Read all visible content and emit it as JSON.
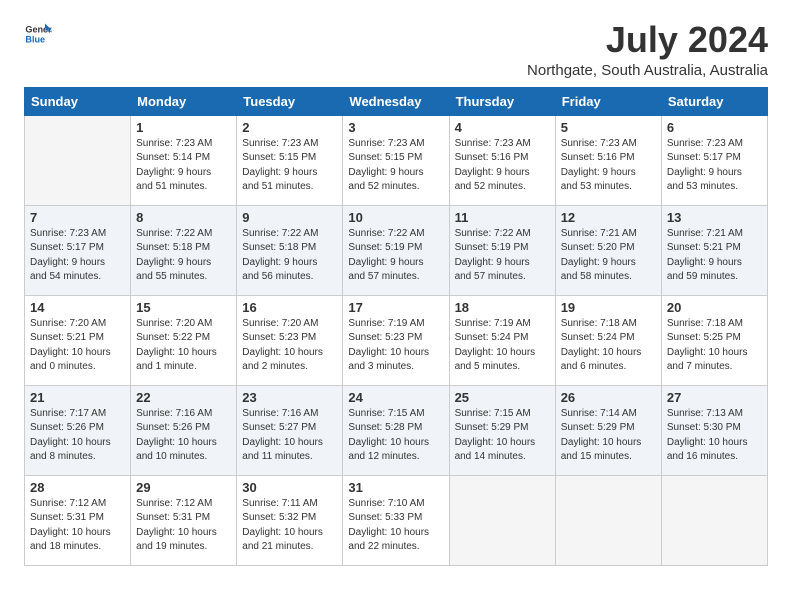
{
  "logo": {
    "general": "General",
    "blue": "Blue"
  },
  "title": {
    "month_year": "July 2024",
    "location": "Northgate, South Australia, Australia"
  },
  "weekdays": [
    "Sunday",
    "Monday",
    "Tuesday",
    "Wednesday",
    "Thursday",
    "Friday",
    "Saturday"
  ],
  "weeks": [
    [
      {
        "day": "",
        "info": ""
      },
      {
        "day": "1",
        "info": "Sunrise: 7:23 AM\nSunset: 5:14 PM\nDaylight: 9 hours\nand 51 minutes."
      },
      {
        "day": "2",
        "info": "Sunrise: 7:23 AM\nSunset: 5:15 PM\nDaylight: 9 hours\nand 51 minutes."
      },
      {
        "day": "3",
        "info": "Sunrise: 7:23 AM\nSunset: 5:15 PM\nDaylight: 9 hours\nand 52 minutes."
      },
      {
        "day": "4",
        "info": "Sunrise: 7:23 AM\nSunset: 5:16 PM\nDaylight: 9 hours\nand 52 minutes."
      },
      {
        "day": "5",
        "info": "Sunrise: 7:23 AM\nSunset: 5:16 PM\nDaylight: 9 hours\nand 53 minutes."
      },
      {
        "day": "6",
        "info": "Sunrise: 7:23 AM\nSunset: 5:17 PM\nDaylight: 9 hours\nand 53 minutes."
      }
    ],
    [
      {
        "day": "7",
        "info": "Sunrise: 7:23 AM\nSunset: 5:17 PM\nDaylight: 9 hours\nand 54 minutes."
      },
      {
        "day": "8",
        "info": "Sunrise: 7:22 AM\nSunset: 5:18 PM\nDaylight: 9 hours\nand 55 minutes."
      },
      {
        "day": "9",
        "info": "Sunrise: 7:22 AM\nSunset: 5:18 PM\nDaylight: 9 hours\nand 56 minutes."
      },
      {
        "day": "10",
        "info": "Sunrise: 7:22 AM\nSunset: 5:19 PM\nDaylight: 9 hours\nand 57 minutes."
      },
      {
        "day": "11",
        "info": "Sunrise: 7:22 AM\nSunset: 5:19 PM\nDaylight: 9 hours\nand 57 minutes."
      },
      {
        "day": "12",
        "info": "Sunrise: 7:21 AM\nSunset: 5:20 PM\nDaylight: 9 hours\nand 58 minutes."
      },
      {
        "day": "13",
        "info": "Sunrise: 7:21 AM\nSunset: 5:21 PM\nDaylight: 9 hours\nand 59 minutes."
      }
    ],
    [
      {
        "day": "14",
        "info": "Sunrise: 7:20 AM\nSunset: 5:21 PM\nDaylight: 10 hours\nand 0 minutes."
      },
      {
        "day": "15",
        "info": "Sunrise: 7:20 AM\nSunset: 5:22 PM\nDaylight: 10 hours\nand 1 minute."
      },
      {
        "day": "16",
        "info": "Sunrise: 7:20 AM\nSunset: 5:23 PM\nDaylight: 10 hours\nand 2 minutes."
      },
      {
        "day": "17",
        "info": "Sunrise: 7:19 AM\nSunset: 5:23 PM\nDaylight: 10 hours\nand 3 minutes."
      },
      {
        "day": "18",
        "info": "Sunrise: 7:19 AM\nSunset: 5:24 PM\nDaylight: 10 hours\nand 5 minutes."
      },
      {
        "day": "19",
        "info": "Sunrise: 7:18 AM\nSunset: 5:24 PM\nDaylight: 10 hours\nand 6 minutes."
      },
      {
        "day": "20",
        "info": "Sunrise: 7:18 AM\nSunset: 5:25 PM\nDaylight: 10 hours\nand 7 minutes."
      }
    ],
    [
      {
        "day": "21",
        "info": "Sunrise: 7:17 AM\nSunset: 5:26 PM\nDaylight: 10 hours\nand 8 minutes."
      },
      {
        "day": "22",
        "info": "Sunrise: 7:16 AM\nSunset: 5:26 PM\nDaylight: 10 hours\nand 10 minutes."
      },
      {
        "day": "23",
        "info": "Sunrise: 7:16 AM\nSunset: 5:27 PM\nDaylight: 10 hours\nand 11 minutes."
      },
      {
        "day": "24",
        "info": "Sunrise: 7:15 AM\nSunset: 5:28 PM\nDaylight: 10 hours\nand 12 minutes."
      },
      {
        "day": "25",
        "info": "Sunrise: 7:15 AM\nSunset: 5:29 PM\nDaylight: 10 hours\nand 14 minutes."
      },
      {
        "day": "26",
        "info": "Sunrise: 7:14 AM\nSunset: 5:29 PM\nDaylight: 10 hours\nand 15 minutes."
      },
      {
        "day": "27",
        "info": "Sunrise: 7:13 AM\nSunset: 5:30 PM\nDaylight: 10 hours\nand 16 minutes."
      }
    ],
    [
      {
        "day": "28",
        "info": "Sunrise: 7:12 AM\nSunset: 5:31 PM\nDaylight: 10 hours\nand 18 minutes."
      },
      {
        "day": "29",
        "info": "Sunrise: 7:12 AM\nSunset: 5:31 PM\nDaylight: 10 hours\nand 19 minutes."
      },
      {
        "day": "30",
        "info": "Sunrise: 7:11 AM\nSunset: 5:32 PM\nDaylight: 10 hours\nand 21 minutes."
      },
      {
        "day": "31",
        "info": "Sunrise: 7:10 AM\nSunset: 5:33 PM\nDaylight: 10 hours\nand 22 minutes."
      },
      {
        "day": "",
        "info": ""
      },
      {
        "day": "",
        "info": ""
      },
      {
        "day": "",
        "info": ""
      }
    ]
  ]
}
